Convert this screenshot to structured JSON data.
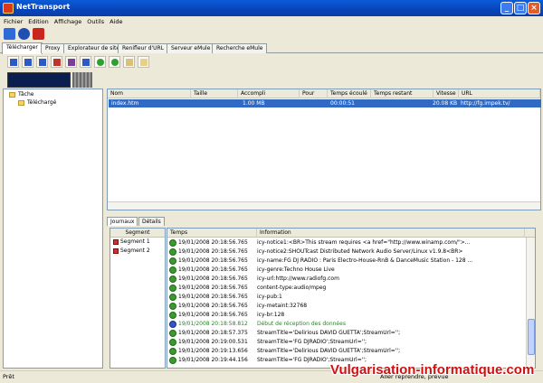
{
  "window": {
    "title": "NetTransport"
  },
  "menu": [
    "Fichier",
    "Edition",
    "Affichage",
    "Outils",
    "Aide"
  ],
  "main_tabs": [
    "Télécharger",
    "Proxy",
    "Explorateur de site",
    "Renifleur d'URL",
    "Serveur eMule",
    "Recherche eMule"
  ],
  "tree": {
    "root": "Tâche",
    "child": "Téléchargé"
  },
  "download_list": {
    "columns": [
      "Nom",
      "Taille",
      "Accompli",
      "Pour cent",
      "Temps écoulé",
      "Temps restant",
      "Vitesse",
      "URL"
    ],
    "rows": [
      {
        "name": "index.htm",
        "size": "",
        "done": "1.00 MB",
        "percent": "",
        "elapsed": "00:00:51",
        "remaining": "",
        "speed": "20.08 KB",
        "url": "http://fg.impek.tv/"
      }
    ]
  },
  "bottom_tabs": [
    "Journaux",
    "Détails"
  ],
  "segments": {
    "header": "Segment",
    "items": [
      "Segment 1",
      "Segment 2"
    ]
  },
  "log": {
    "columns": [
      "Temps",
      "Information"
    ],
    "rows": [
      {
        "time": "19/01/2008 20:18:56.765",
        "info": "icy-notice1:<BR>This stream requires <a href=\"http://www.winamp.com/\">...",
        "type": "ok"
      },
      {
        "time": "19/01/2008 20:18:56.765",
        "info": "icy-notice2:SHOUTcast Distributed Network Audio Server/Linux v1.9.8<BR>",
        "type": "ok"
      },
      {
        "time": "19/01/2008 20:18:56.765",
        "info": "icy-name:FG DJ RADIO : Paris Electro-House-RnB & DanceMusic Station - 128 ...",
        "type": "ok"
      },
      {
        "time": "19/01/2008 20:18:56.765",
        "info": "icy-genre:Techno House Live",
        "type": "ok"
      },
      {
        "time": "19/01/2008 20:18:56.765",
        "info": "icy-url:http://www.radiofg.com",
        "type": "ok"
      },
      {
        "time": "19/01/2008 20:18:56.765",
        "info": "content-type:audio/mpeg",
        "type": "ok"
      },
      {
        "time": "19/01/2008 20:18:56.765",
        "info": "icy-pub:1",
        "type": "ok"
      },
      {
        "time": "19/01/2008 20:18:56.765",
        "info": "icy-metaint:32768",
        "type": "ok"
      },
      {
        "time": "19/01/2008 20:18:56.765",
        "info": "icy-br:128",
        "type": "ok"
      },
      {
        "time": "19/01/2008 20:18:58.812",
        "info": "Début de réception des données",
        "type": "info"
      },
      {
        "time": "19/01/2008 20:18:57.375",
        "info": "StreamTitle='Delirious          DAVID GUETTA';StreamUrl='';",
        "type": "ok"
      },
      {
        "time": "19/01/2008 20:19:00.531",
        "info": "StreamTitle='FG DJRADIO';StreamUrl='';",
        "type": "ok"
      },
      {
        "time": "19/01/2008 20:19:13.656",
        "info": "StreamTitle='Delirious          DAVID GUETTA';StreamUrl='';",
        "type": "ok"
      },
      {
        "time": "19/01/2008 20:19:44.156",
        "info": "StreamTitle='FG DJRADIO';StreamUrl='';",
        "type": "ok"
      }
    ]
  },
  "status": {
    "left": "Prêt",
    "right": "Aller reprendre, prévue"
  },
  "watermark": "Vulgarisation-informatique.com",
  "colors": {
    "title_bar": "#0a5bd8",
    "selection": "#316ac5",
    "watermark": "#d01010",
    "log_green": "#1f8a1f"
  }
}
